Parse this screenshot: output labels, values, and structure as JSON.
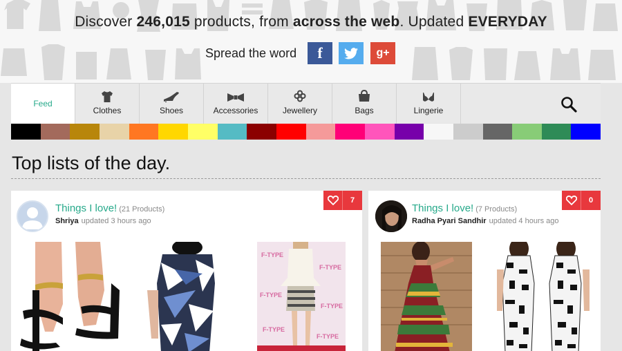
{
  "hero": {
    "headline_pre": "Discover ",
    "headline_count": "246,015",
    "headline_mid": " products, from ",
    "headline_web": "across the web",
    "headline_post": ". Updated ",
    "headline_freq": "EVERYDAY",
    "spread_label": "Spread the word",
    "social": [
      {
        "icon": "facebook-icon",
        "glyph": "f",
        "color": "#3b5998"
      },
      {
        "icon": "twitter-icon",
        "glyph": "bird",
        "color": "#55acee"
      },
      {
        "icon": "google-plus-icon",
        "glyph": "g+",
        "color": "#dd4b39"
      }
    ]
  },
  "nav": {
    "items": [
      {
        "label": "Feed",
        "icon": ""
      },
      {
        "label": "Clothes",
        "icon": "tshirt-icon"
      },
      {
        "label": "Shoes",
        "icon": "heel-icon"
      },
      {
        "label": "Accessories",
        "icon": "bowtie-icon"
      },
      {
        "label": "Jewellery",
        "icon": "ring-icon"
      },
      {
        "label": "Bags",
        "icon": "bag-icon"
      },
      {
        "label": "Lingerie",
        "icon": "bra-icon"
      }
    ],
    "search_icon": "search-icon",
    "accent": "#26a98a"
  },
  "colors": [
    "#000000",
    "#a36a5c",
    "#b8860b",
    "#e8d3a8",
    "#ff7722",
    "#ffd700",
    "#ffff66",
    "#55bbc4",
    "#8b0000",
    "#ff0000",
    "#f59a9a",
    "#ff0077",
    "#ff55bb",
    "#7700aa",
    "#f7f7f7",
    "#cccccc",
    "#666666",
    "#88cc77",
    "#2e8b57",
    "#0000ff"
  ],
  "section_title": "Top lists of the day.",
  "cards": [
    {
      "title": "Things I love!",
      "count": "(21 Products)",
      "user": "Shriya",
      "updated": "updated 3 hours ago",
      "likes": "7"
    },
    {
      "title": "Things I love!",
      "count": "(7 Products)",
      "user": "Radha Pyari Sandhir",
      "updated": "updated 4 hours ago",
      "likes": "0"
    }
  ]
}
